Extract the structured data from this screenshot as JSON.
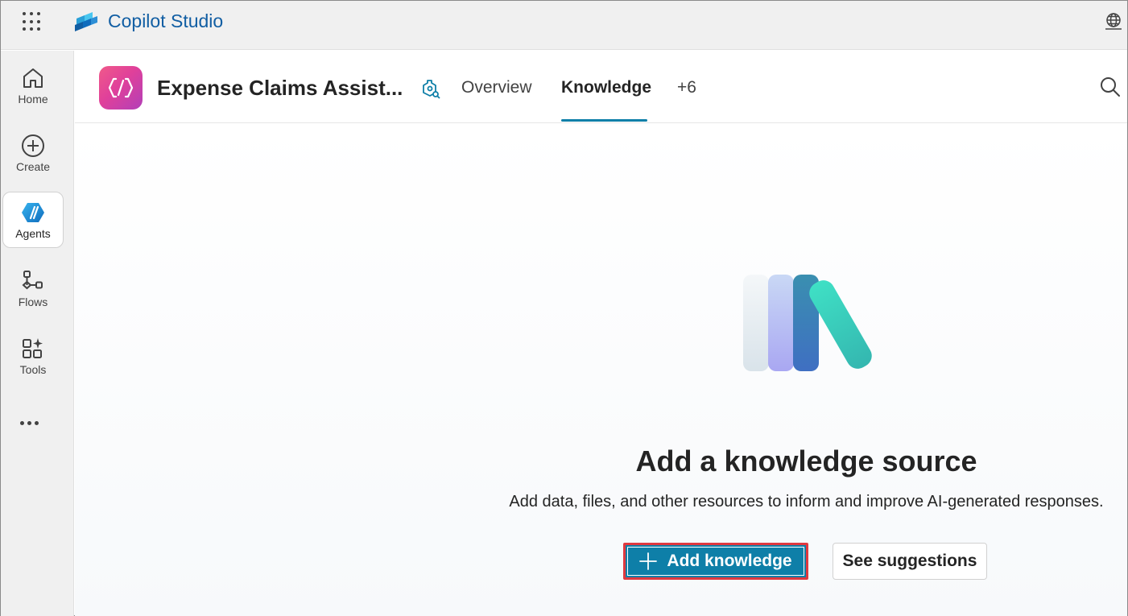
{
  "app": {
    "name": "Copilot Studio"
  },
  "rail": {
    "items": [
      {
        "label": "Home",
        "icon": "home-icon"
      },
      {
        "label": "Create",
        "icon": "add-circle-icon"
      },
      {
        "label": "Agents",
        "icon": "agents-icon",
        "active": true
      },
      {
        "label": "Flows",
        "icon": "flows-icon"
      },
      {
        "label": "Tools",
        "icon": "tools-icon"
      }
    ],
    "more_icon": "more-horizontal-icon"
  },
  "agent": {
    "name": "Expense Claims Assist...",
    "tabs": [
      {
        "label": "Overview",
        "active": false
      },
      {
        "label": "Knowledge",
        "active": true
      },
      {
        "label": "+6",
        "active": false
      }
    ]
  },
  "empty_state": {
    "title": "Add a knowledge source",
    "description": "Add data, files, and other resources to inform and improve AI-generated responses.",
    "primary_button": "Add knowledge",
    "secondary_button": "See suggestions"
  },
  "colors": {
    "brand": "#115ea3",
    "primary_button": "#0e7fa8",
    "highlight_border": "#e0393f",
    "tab_underline": "#0e7fa8"
  }
}
